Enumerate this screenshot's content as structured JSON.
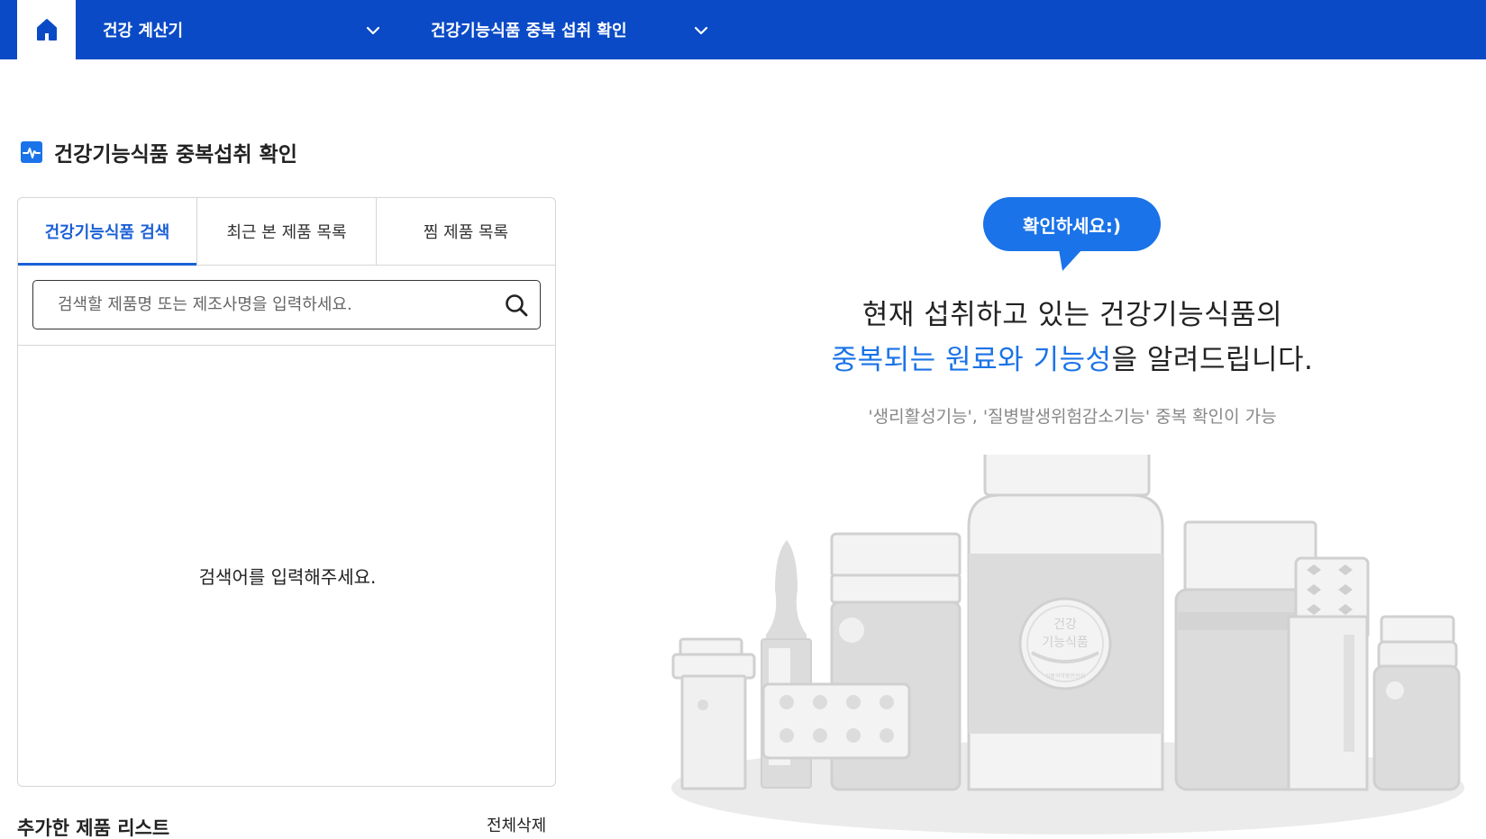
{
  "nav": {
    "home_icon": "home-icon",
    "item1": "건강 계산기",
    "item2": "건강기능식품 중복 섭취 확인",
    "colors": {
      "bar": "#0a4ac6",
      "accent": "#1a73e8"
    }
  },
  "page": {
    "title": "건강기능식품 중복섭취 확인",
    "tabs": [
      "건강기능식품 검색",
      "최근 본 제품 목록",
      "찜 제품 목록"
    ],
    "search_placeholder": "검색할 제품명 또는 제조사명을 입력하세요.",
    "empty_message": "검색어를 입력해주세요.",
    "added_list_title": "추가한 제품 리스트",
    "clear_all": "전체삭제"
  },
  "hero": {
    "bubble": "확인하세요:)",
    "line1": "현재 섭취하고 있는 건강기능식품의",
    "line2_highlight": "중복되는 원료와 기능성",
    "line2_rest": "을 알려드립니다.",
    "note": "'생리활성기능', '질병발생위험감소기능' 중복 확인이 가능",
    "badge_line1": "건강",
    "badge_line2": "기능식품",
    "badge_small": "식품의약품안전처"
  }
}
